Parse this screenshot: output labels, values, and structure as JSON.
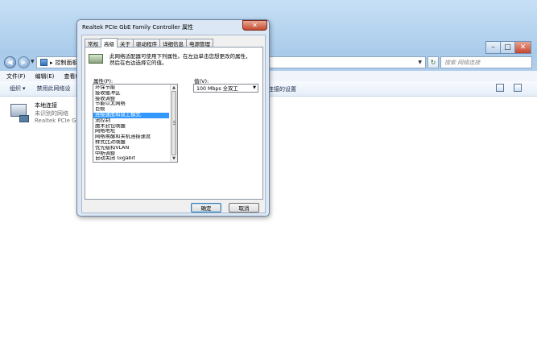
{
  "explorer": {
    "address": {
      "path": "控制面板",
      "placeholder": "搜索 网络连接"
    },
    "menu": [
      "文件(F)",
      "编辑(E)",
      "查看(V)"
    ],
    "toolbar": {
      "organize": "组织",
      "disable": "禁用此网络设",
      "tail": "连接的设置"
    },
    "adapter": {
      "name": "本地连接",
      "status": "未识别的网络",
      "description": "Realtek PCIe GB"
    }
  },
  "dialog": {
    "title": "Realtek PCIe GbE Family Controller 属性",
    "close": "✕",
    "tabs": [
      "常规",
      "高级",
      "关于",
      "驱动程序",
      "详细信息",
      "电源管理"
    ],
    "active_tab_index": 1,
    "description_line1": "此网络适配器可使用下列属性。在左边单击您想更改的属性，",
    "description_line2": "然后在右边选择它的值。",
    "property_label": "属性(P):",
    "properties": [
      "环保节能",
      "接收缓冲区",
      "接收调整",
      "节能以太网络",
      "巨帧",
      "连接速度和双工模式",
      "流控制",
      "魔术封包唤醒",
      "网络地址",
      "网络唤醒和关机连接速度",
      "样式比对唤醒",
      "优先级和VLAN",
      "中断调整",
      "自动关闭 Gigabit"
    ],
    "selected_property_index": 5,
    "value_label": "值(V):",
    "value_selected": "100 Mbps 全双工",
    "ok": "确定",
    "cancel": "取消"
  },
  "colors": {
    "selection": "#3399ff",
    "glass": "#b7d4ee",
    "close_button": "#c44a2f"
  },
  "icons": [
    "back-arrow-icon",
    "forward-arrow-icon",
    "control-panel-icon",
    "refresh-icon",
    "network-adapter-icon",
    "close-icon"
  ]
}
